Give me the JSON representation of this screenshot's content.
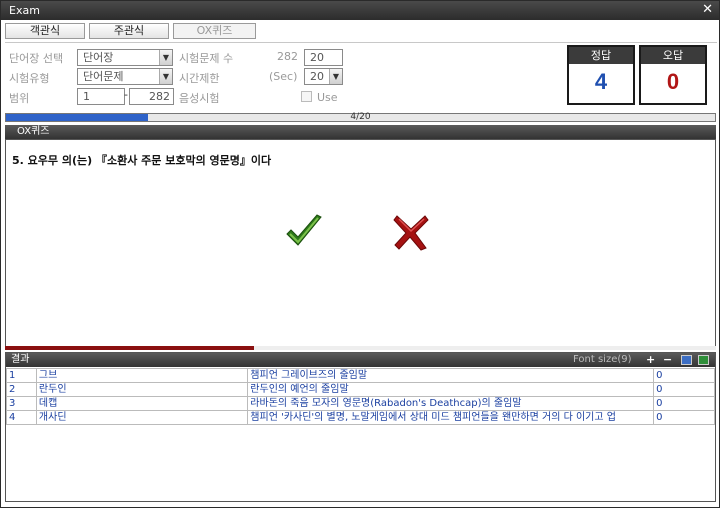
{
  "window": {
    "title": "Exam",
    "close_glyph": "✕"
  },
  "tabs": [
    {
      "label": "객관식"
    },
    {
      "label": "주관식"
    },
    {
      "label": "OX퀴즈"
    }
  ],
  "settings": {
    "word_select_label": "단어장 선택",
    "word_select_value": "단어장",
    "exam_type_label": "시험유형",
    "exam_type_value": "단어문제",
    "range_label": "범위",
    "range_from": "1",
    "range_sep": "-",
    "range_to": "282",
    "question_count_label": "시험문제 수",
    "question_count_total": "282",
    "question_count_value": "20",
    "time_limit_label": "시간제한",
    "time_limit_unit": "(Sec)",
    "time_limit_value": "20",
    "voice_label": "음성시험",
    "use_label": "Use"
  },
  "score": {
    "correct_label": "정답",
    "correct_value": "4",
    "wrong_label": "오답",
    "wrong_value": "0",
    "correct_color": "#1f4fb0",
    "wrong_color": "#b11616"
  },
  "progress": {
    "text": "4/20",
    "fraction": 0.2
  },
  "quiz": {
    "header": "OX퀴즈",
    "question": "5. 요우무 의(는) 『소환사 주문 보호막의 영문명』이다",
    "o_icon": "checkmark-icon",
    "x_icon": "cross-icon",
    "timer_fraction": 0.35
  },
  "results": {
    "header": "결과",
    "font_size_label": "Font size(9)",
    "plus": "+",
    "minus": "−",
    "rows": [
      {
        "num": "1",
        "word": "그브",
        "meaning": "챔피언 그레이브즈의 줄임말",
        "score": "0"
      },
      {
        "num": "2",
        "word": "란두인",
        "meaning": "란두인의 예언의 줄임말",
        "score": "0"
      },
      {
        "num": "3",
        "word": "데캡",
        "meaning": "라바돈의 죽음 모자의 영문명(Rabadon's Deathcap)의 줄임말",
        "score": "0"
      },
      {
        "num": "4",
        "word": "개사딘",
        "meaning": "챔피언 '카사딘'의 별명, 노말게임에서 상대 미드 챔피언들을 왠만하면 거의 다 이기고 업",
        "score": "0"
      }
    ]
  }
}
